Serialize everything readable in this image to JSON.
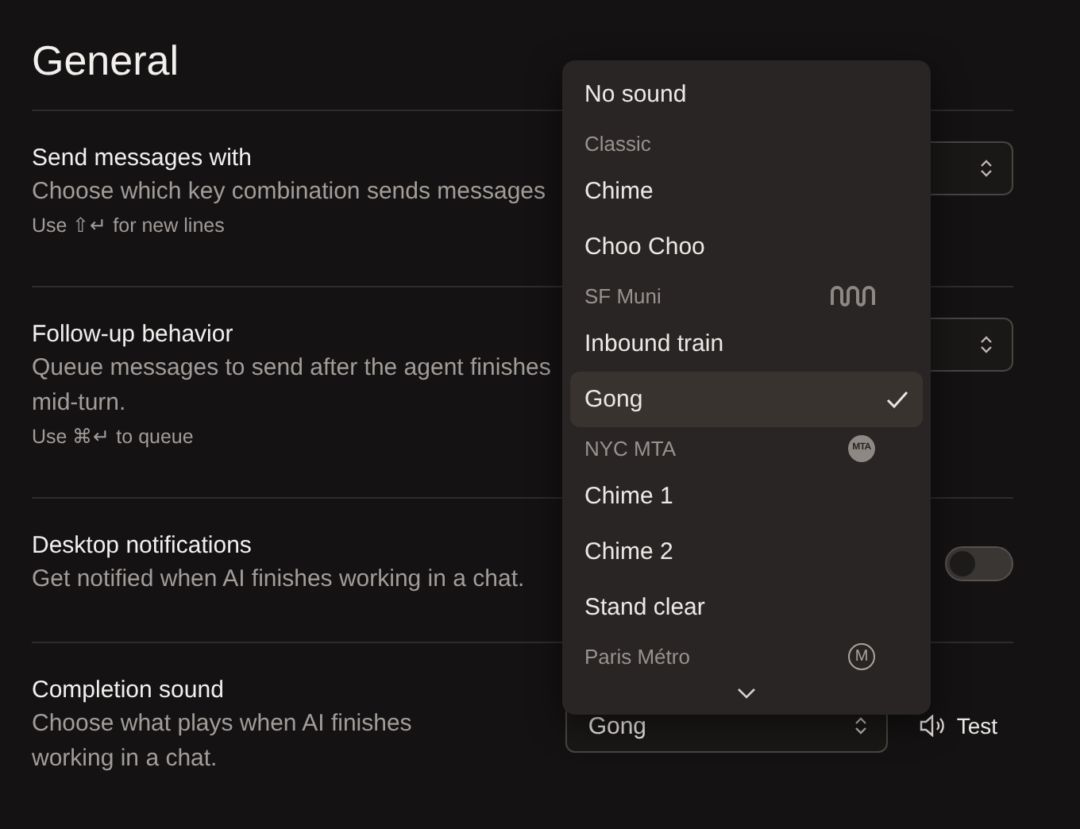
{
  "title": "General",
  "rows": [
    {
      "label": "Send messages with",
      "description": "Choose which key combination sends messages",
      "hint": "Use ⇧↵ for new lines",
      "control": {
        "kind": "select"
      }
    },
    {
      "label": "Follow-up behavior",
      "description": "Queue messages to send after the agent finishes mid-turn.",
      "hint": "Use ⌘↵ to queue",
      "control": {
        "kind": "select"
      }
    },
    {
      "label": "Desktop notifications",
      "description": "Get notified when AI finishes working in a chat.",
      "control": {
        "kind": "toggle",
        "on": false
      }
    },
    {
      "label": "Completion sound",
      "description": "Choose what plays when AI finishes working in a chat.",
      "control": {
        "kind": "sound",
        "value": "Gong",
        "test_label": "Test"
      }
    }
  ],
  "dropdown": {
    "items": [
      {
        "kind": "option",
        "label": "No sound",
        "selected": false
      },
      {
        "kind": "header",
        "label": "Classic"
      },
      {
        "kind": "option",
        "label": "Chime",
        "selected": false
      },
      {
        "kind": "option",
        "label": "Choo Choo",
        "selected": false
      },
      {
        "kind": "waveheader",
        "label": "SF Muni"
      },
      {
        "kind": "option",
        "label": "Inbound train",
        "selected": false
      },
      {
        "kind": "option",
        "label": "Gong",
        "selected": true
      },
      {
        "kind": "sealheader",
        "label": "NYC MTA",
        "badge": "MTA"
      },
      {
        "kind": "option",
        "label": "Chime 1",
        "selected": false
      },
      {
        "kind": "option",
        "label": "Chime 2",
        "selected": false
      },
      {
        "kind": "option",
        "label": "Stand clear",
        "selected": false
      },
      {
        "kind": "ringheader",
        "label": "Paris Métro",
        "badge": "M"
      }
    ],
    "more_below": true
  }
}
